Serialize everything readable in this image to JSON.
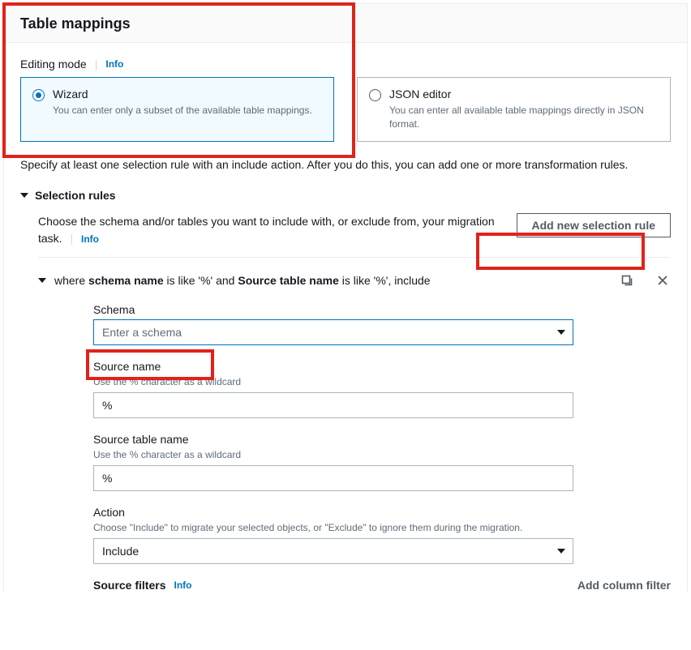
{
  "panel": {
    "title": "Table mappings"
  },
  "mode": {
    "label": "Editing mode",
    "info": "Info",
    "wizard": {
      "title": "Wizard",
      "desc": "You can enter only a subset of the available table mappings."
    },
    "json": {
      "title": "JSON editor",
      "desc": "You can enter all available table mappings directly in JSON format."
    }
  },
  "instruction": "Specify at least one selection rule with an include action. After you do this, you can add one or more transformation rules.",
  "selection": {
    "title": "Selection rules",
    "desc": "Choose the schema and/or tables you want to include with, or exclude from, your migration task.",
    "info": "Info",
    "addBtn": "Add new selection rule"
  },
  "rule": {
    "prefix": "where ",
    "schemaLabel": "schema name",
    "mid1": " is like '%' and ",
    "tableLabel": "Source table name",
    "mid2": " is like '%', include",
    "schema": {
      "label": "Schema",
      "placeholder": "Enter a schema"
    },
    "sourceName": {
      "label": "Source name",
      "hint": "Use the % character as a wildcard",
      "value": "%"
    },
    "sourceTable": {
      "label": "Source table name",
      "hint": "Use the % character as a wildcard",
      "value": "%"
    },
    "action": {
      "label": "Action",
      "hint": "Choose \"Include\" to migrate your selected objects, or \"Exclude\" to ignore them during the migration.",
      "value": "Include"
    }
  },
  "filters": {
    "label": "Source filters",
    "info": "Info",
    "addBtn": "Add column filter"
  }
}
